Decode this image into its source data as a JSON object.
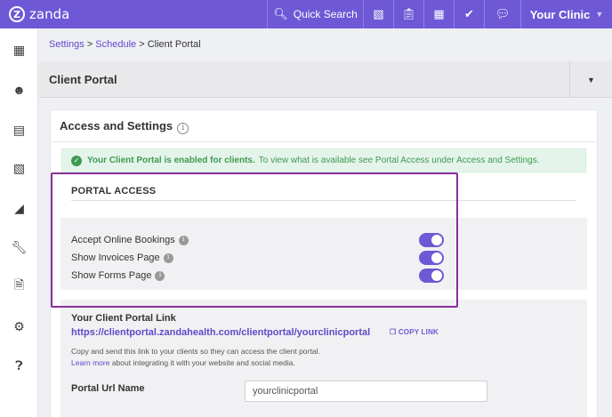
{
  "topbar": {
    "logo_text": "zanda",
    "search_label": "Quick Search",
    "clinic_label": "Your Clinic",
    "accent_color": "#6e58d6",
    "icons": [
      "bar-chart-icon",
      "clipboard-icon",
      "calendar-icon",
      "check-circle-icon",
      "chat-icon"
    ]
  },
  "sidebar": {
    "icons": [
      "calendar-icon",
      "users-icon",
      "id-card-icon",
      "bar-chart-icon",
      "line-chart-icon",
      "wrench-icon",
      "document-icon",
      "gear-icon",
      "help-icon"
    ]
  },
  "breadcrumb": {
    "settings": "Settings",
    "sep1": " > ",
    "schedule": "Schedule",
    "sep2": " > ",
    "current": "Client Portal"
  },
  "header": {
    "title": "Client Portal"
  },
  "card": {
    "title": "Access and Settings",
    "alert_bold": "Your Client Portal is enabled for clients.",
    "alert_text": "To view what is available see Portal Access under Access and Settings.",
    "section_title": "PORTAL ACCESS",
    "toggles": [
      {
        "label": "Accept Online Bookings",
        "on": true
      },
      {
        "label": "Show Invoices Page",
        "on": true
      },
      {
        "label": "Show Forms Page",
        "on": true
      }
    ],
    "link": {
      "title": "Your Client Portal Link",
      "url": "https://clientportal.zandahealth.com/clientportal/yourclinicportal",
      "copy_label": "COPY LINK",
      "desc1": "Copy and send this link to your clients so they can access the client portal.",
      "learn_more": "Learn more",
      "desc2_rest": " about integrating it with your website and social media.",
      "url_name_label": "Portal Url Name",
      "url_name_value": "yourclinicportal"
    }
  }
}
